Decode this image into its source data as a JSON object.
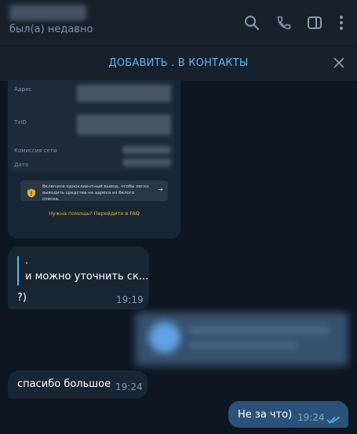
{
  "header": {
    "status": "был(а) недавно",
    "icons": [
      "search-icon",
      "phone-icon",
      "sidebar-icon",
      "more-icon"
    ]
  },
  "add_bar": {
    "label": "ДОБАВИТЬ . В КОНТАКТЫ"
  },
  "receipt": {
    "labels": [
      "Адрес",
      "TxID",
      "Комиссия сети",
      "Дата"
    ],
    "notice": "Включите одноклиентный вывод, чтобы легко выводить средства на адреса из белого списка.",
    "faq": "Нужна помощь? Перейдите в FAQ"
  },
  "messages": [
    {
      "quote": ".",
      "quote_text": "и можно уточнить ск...",
      "text": "?)",
      "time": "19:19"
    },
    {
      "text": "спасибо большое",
      "time": "19:24"
    },
    {
      "text": "Не за что)",
      "time": "19:24"
    }
  ],
  "colors": {
    "accent": "#5eb5f7",
    "faq": "#e8b339",
    "bg": "#0e1621"
  }
}
